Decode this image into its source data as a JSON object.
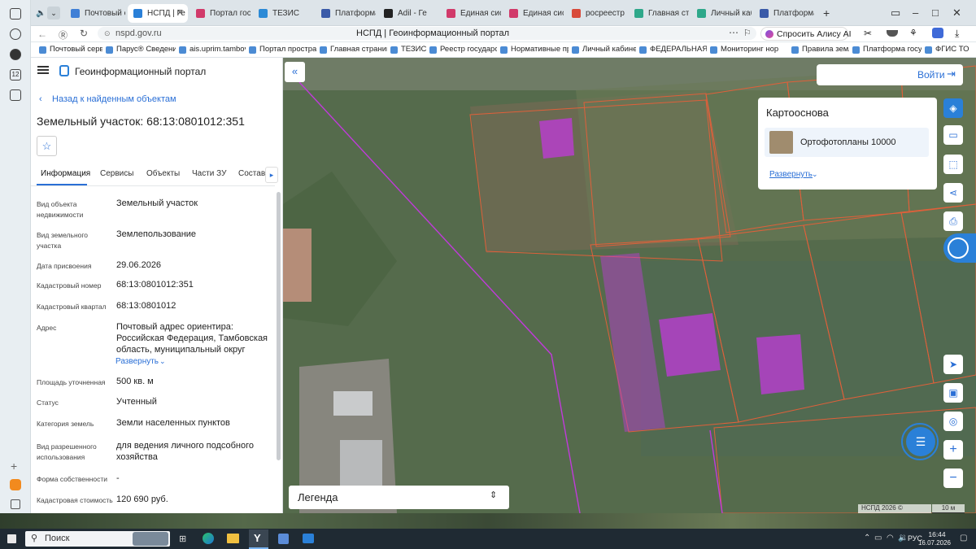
{
  "browser": {
    "tabs": [
      {
        "label": "Почтовый се",
        "color": "#3f7fd6"
      },
      {
        "label": "НСПД | Ге",
        "color": "#2a80d8",
        "active": true
      },
      {
        "label": "Портал госу",
        "color": "#d13a6a"
      },
      {
        "label": "ТЕЗИС",
        "color": "#2c8ad6"
      },
      {
        "label": "Платформа",
        "color": "#3a5aa8"
      },
      {
        "label": "Adil - Ге",
        "color": "#222222"
      },
      {
        "label": "Единая сист",
        "color": "#d13a6a"
      },
      {
        "label": "Единая сист",
        "color": "#d13a6a"
      },
      {
        "label": "росреестр –",
        "color": "#d84a3a"
      },
      {
        "label": "Главная стр",
        "color": "#2ea88a"
      },
      {
        "label": "Личный каб",
        "color": "#2ea88a"
      },
      {
        "label": "Платформа",
        "color": "#3a5aa8"
      }
    ],
    "url": "nspd.gov.ru",
    "page_title": "НСПД | Геоинформационный портал",
    "alice_button": "Спросить Алису AI",
    "bookmarks": [
      "Почтовый сервер",
      "Парус® Сведени",
      "ais.uprim.tambov",
      "Портал простран",
      "Главная страниц",
      "ТЕЗИС",
      "Реестр государст",
      "Нормативные пр",
      "Личный кабинет",
      "ФЕДЕРАЛЬНАЯ",
      "Мониторинг нор",
      "Правила землеп",
      "Платформа госуд",
      "ФГИС ТО"
    ],
    "left_badge": "12"
  },
  "portal": {
    "title": "Геоинформационный портал",
    "back": "Назад к найденным объектам",
    "object_title": "Земельный участок: 68:13:0801012:351",
    "tabs": [
      "Информация",
      "Сервисы",
      "Объекты",
      "Части ЗУ",
      "Состав"
    ],
    "fields": [
      {
        "label": "Вид объекта недвижимости",
        "value": "Земельный участок"
      },
      {
        "label": "Вид земельного участка",
        "value": "Землепользование"
      },
      {
        "label": "Дата присвоения",
        "value": "29.06.2026"
      },
      {
        "label": "Кадастровый номер",
        "value": "68:13:0801012:351"
      },
      {
        "label": "Кадастровый квартал",
        "value": "68:13:0801012"
      },
      {
        "label": "Адрес",
        "value": "Почтовый адрес ориентира: Российская Федерация, Тамбовская область, муниципальный округ"
      },
      {
        "label": "Площадь уточненная",
        "value": "500 кв. м"
      },
      {
        "label": "Статус",
        "value": "Учтенный"
      },
      {
        "label": "Категория земель",
        "value": "Земли населенных пунктов"
      },
      {
        "label": "Вид разрешенного использования",
        "value": "для ведения личного подсобного хозяйства"
      },
      {
        "label": "Форма собственности",
        "value": "-"
      },
      {
        "label": "Кадастровая стоимость",
        "value": "120 690 руб."
      }
    ],
    "expand": "Развернуть"
  },
  "map": {
    "login": "Войти",
    "karto_title": "Картооснова",
    "karto_item": "Ортофотопланы 10000",
    "karto_expand": "Развернуть",
    "legend": "Легенда",
    "attrib": "НСПД 2026 ©",
    "scale": "10 м",
    "plot_color": "#c13adb",
    "boundary_color": "#e0603a"
  },
  "taskbar": {
    "search": "Поиск",
    "lang": "РУС",
    "time": "16:44",
    "date": "16.07.2026"
  }
}
